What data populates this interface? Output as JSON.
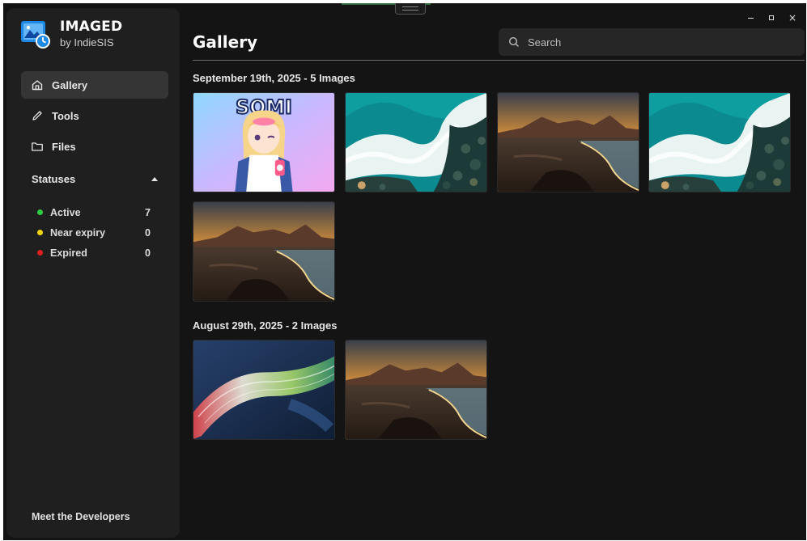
{
  "app": {
    "title": "IMAGED",
    "subtitle": "by IndieSIS"
  },
  "window_controls": {
    "close_label": "×"
  },
  "sidebar": {
    "nav": [
      {
        "label": "Gallery",
        "icon": "home-icon",
        "active": true
      },
      {
        "label": "Tools",
        "icon": "pencil-icon",
        "active": false
      },
      {
        "label": "Files",
        "icon": "folder-icon",
        "active": false
      }
    ],
    "statuses_label": "Statuses",
    "statuses": [
      {
        "label": "Active",
        "count": "7",
        "color": "#2ecc40"
      },
      {
        "label": "Near expiry",
        "count": "0",
        "color": "#f1d40f"
      },
      {
        "label": "Expired",
        "count": "0",
        "color": "#e02020"
      }
    ],
    "footer_link": "Meet the Developers"
  },
  "main": {
    "title": "Gallery",
    "search_placeholder": "Search",
    "groups": [
      {
        "label": "September 19th, 2025 - 5 Images",
        "images": [
          {
            "kind": "anime",
            "text": "SOMI"
          },
          {
            "kind": "wave"
          },
          {
            "kind": "beach"
          },
          {
            "kind": "wave"
          },
          {
            "kind": "beach"
          }
        ]
      },
      {
        "label": "August 29th, 2025 - 2 Images",
        "images": [
          {
            "kind": "abstract"
          },
          {
            "kind": "beach"
          }
        ]
      }
    ]
  },
  "colors": {
    "background": "#141414",
    "sidebar": "#1f1f1f",
    "active_nav": "#353535",
    "search": "#262626"
  }
}
